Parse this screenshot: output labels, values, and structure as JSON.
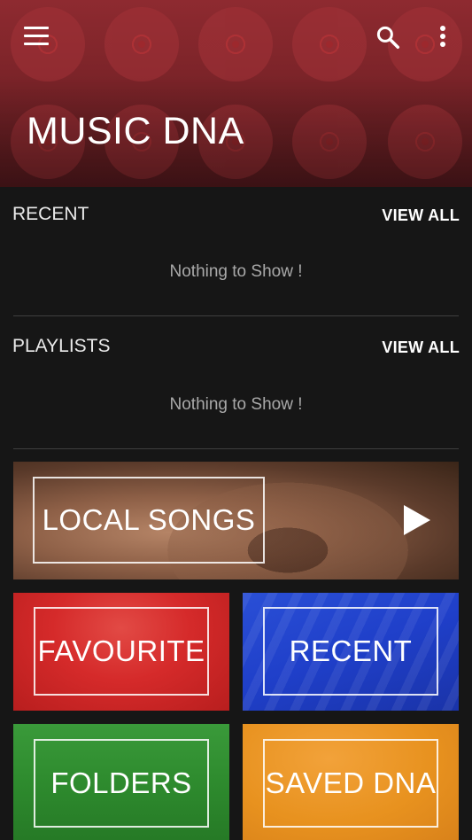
{
  "header": {
    "title": "MUSIC DNA",
    "menu_icon": "hamburger-menu-icon",
    "search_icon": "search-icon",
    "more_icon": "more-vert-icon",
    "accent": "#8e2a30"
  },
  "recent": {
    "title": "RECENT",
    "view_all": "VIEW ALL",
    "empty_text": "Nothing to Show !"
  },
  "playlists": {
    "title": "PLAYLISTS",
    "view_all": "VIEW ALL",
    "empty_text": "Nothing to Show !"
  },
  "tiles": {
    "local_songs": {
      "label": "LOCAL SONGS",
      "icon": "play-icon"
    },
    "favourite": {
      "label": "FAVOURITE",
      "color": "#d52a2a"
    },
    "recent": {
      "label": "RECENT",
      "color": "#1f3fc9"
    },
    "folders": {
      "label": "FOLDERS",
      "color": "#2e8b2e"
    },
    "saved_dna": {
      "label": "SAVED DNA",
      "color": "#e8921f"
    }
  }
}
